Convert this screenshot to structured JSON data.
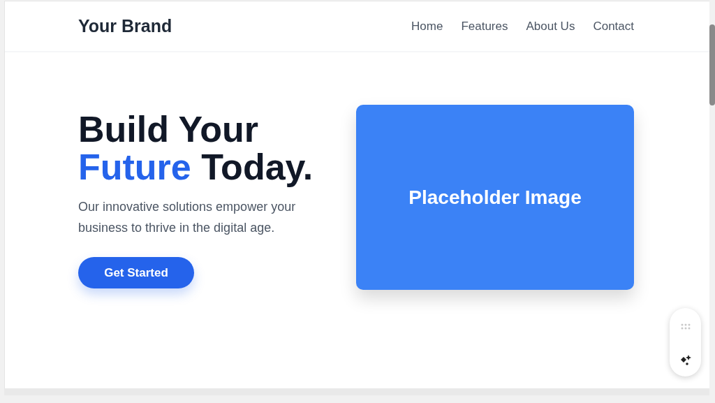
{
  "header": {
    "brand": "Your Brand",
    "nav": [
      {
        "label": "Home"
      },
      {
        "label": "Features"
      },
      {
        "label": "About Us"
      },
      {
        "label": "Contact"
      }
    ]
  },
  "hero": {
    "headline": {
      "line_1": "Build Your",
      "highlight": "Future",
      "rest": "Today."
    },
    "text": "Our innovative solutions empower your business to thrive in the digital age.",
    "button": "Get Started",
    "image_label": "Placeholder Image"
  }
}
